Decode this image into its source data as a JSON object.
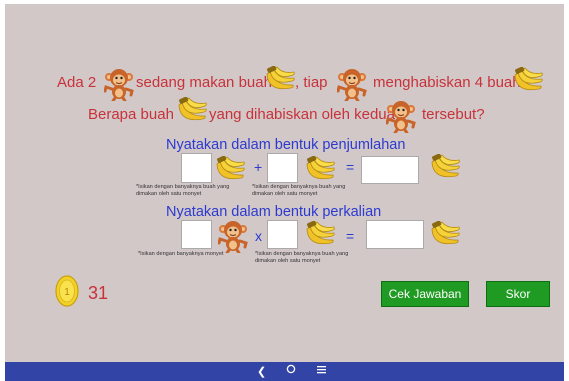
{
  "question": {
    "line1_part1": "Ada 2",
    "line1_part2": "sedang makan buah",
    "line1_part3": ", tiap",
    "line1_part4": "menghabiskan 4 buah",
    "line2_part1": "Berapa buah",
    "line2_part2": "yang dihabiskan oleh kedua",
    "line2_part3": "tersebut?"
  },
  "addition": {
    "heading": "Nyatakan dalam bentuk penjumlahan",
    "plus": "+",
    "equals": "=",
    "hint_left": "*Isikan dengan banyaknya buah yang dimakan oleh satu monyet",
    "hint_right": "*Isikan dengan banyaknya buah yang dimakan oleh satu monyet"
  },
  "multiplication": {
    "heading": "Nyatakan dalam bentuk perkalian",
    "times": "x",
    "equals": "=",
    "hint_left": "*Isikan dengan banyaknya monyet",
    "hint_right": "*Isikan dengan banyaknya buah yang dimakan oleh satu monyet"
  },
  "coin": {
    "symbol": "1",
    "count": "31"
  },
  "buttons": {
    "check": "Cek Jawaban",
    "score": "Skor"
  },
  "colors": {
    "question": "#c8323a",
    "heading": "#2c3ad0",
    "button": "#1f9a22",
    "navbar": "#3245a6",
    "background": "#d3c8c8"
  },
  "icons": [
    "monkey-icon",
    "banana-icon",
    "coin-icon",
    "back-icon",
    "home-icon",
    "menu-icon"
  ]
}
